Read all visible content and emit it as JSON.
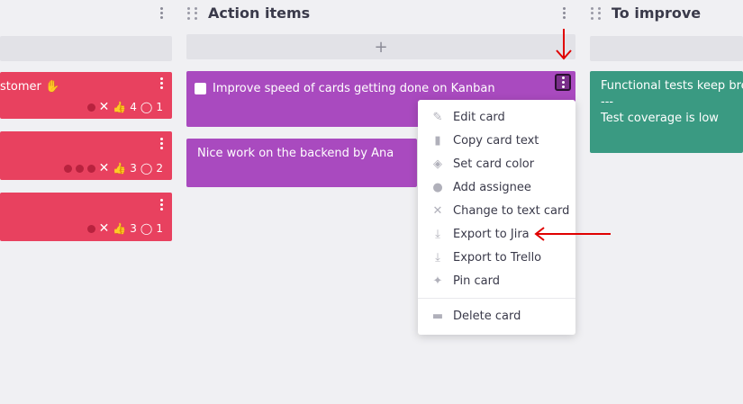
{
  "columns": [
    {
      "title": ""
    },
    {
      "title": "Action items"
    },
    {
      "title": "To improve"
    }
  ],
  "add_label": "+",
  "left_cards": [
    {
      "text": "stomer ✋",
      "dots": 1,
      "likes": "4",
      "comments": "1"
    },
    {
      "text": "",
      "dots": 3,
      "likes": "3",
      "comments": "2"
    },
    {
      "text": "",
      "dots": 1,
      "likes": "3",
      "comments": "1"
    }
  ],
  "action_cards": [
    {
      "text": "Improve speed of cards getting done on Kanban"
    },
    {
      "text": "Nice work on the backend by Ana"
    }
  ],
  "improve_cards": [
    {
      "line1": "Functional tests keep brea",
      "line2": "---",
      "line3": "Test coverage is low"
    }
  ],
  "menu": {
    "items": [
      {
        "label": "Edit card",
        "icon": "pencil-icon"
      },
      {
        "label": "Copy card text",
        "icon": "clipboard-icon"
      },
      {
        "label": "Set card color",
        "icon": "paint-bucket-icon"
      },
      {
        "label": "Add assignee",
        "icon": "user-plus-icon"
      },
      {
        "label": "Change to text card",
        "icon": "x-icon"
      },
      {
        "label": "Export to Jira",
        "icon": "download-icon"
      },
      {
        "label": "Export to Trello",
        "icon": "download-icon"
      },
      {
        "label": "Pin card",
        "icon": "pin-icon"
      }
    ],
    "delete_label": "Delete card"
  },
  "colors": {
    "pink": "#e8415f",
    "purple": "#a94abf",
    "teal": "#3a9a82",
    "annotation": "#e00000"
  }
}
